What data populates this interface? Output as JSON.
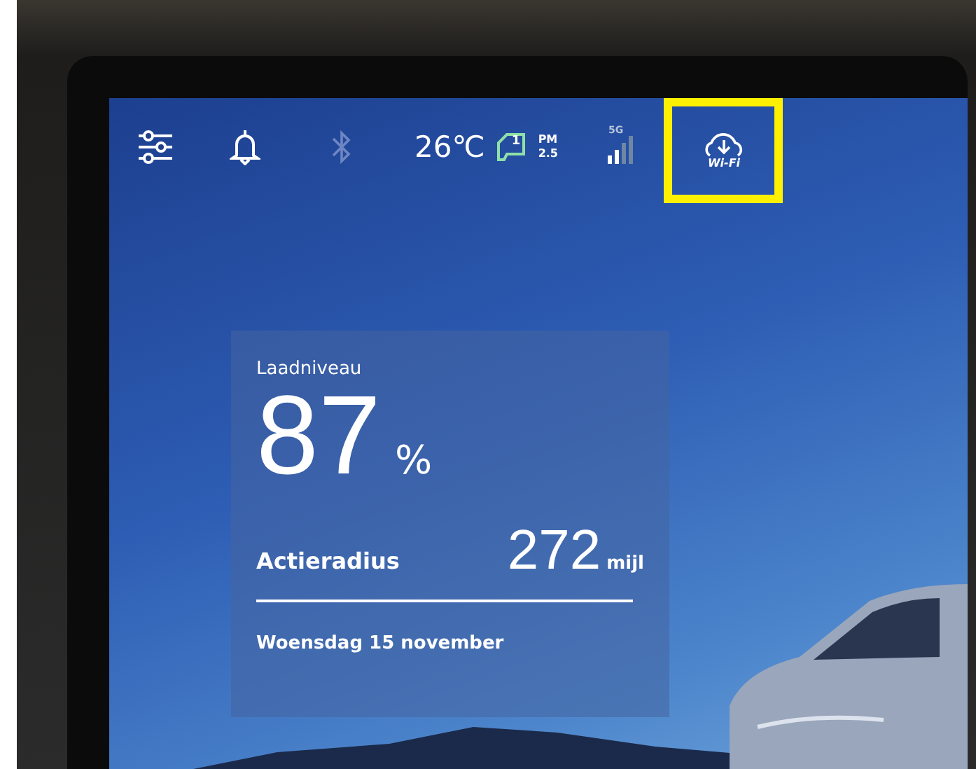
{
  "status_bar": {
    "temperature": "26℃",
    "air_quality": {
      "cabin_label": "1",
      "pm_label": "PM",
      "pm_value": "2.5"
    },
    "network": {
      "label": "5G"
    },
    "bluetooth": {
      "enabled": false
    },
    "wifi": {
      "label": "Wi-Fi",
      "highlighted": true
    }
  },
  "battery_card": {
    "title": "Laadniveau",
    "charge": "87",
    "charge_unit": "%",
    "range_label": "Actieradius",
    "range": "272",
    "range_unit": "mijl",
    "date": "Woensdag 15 november"
  }
}
